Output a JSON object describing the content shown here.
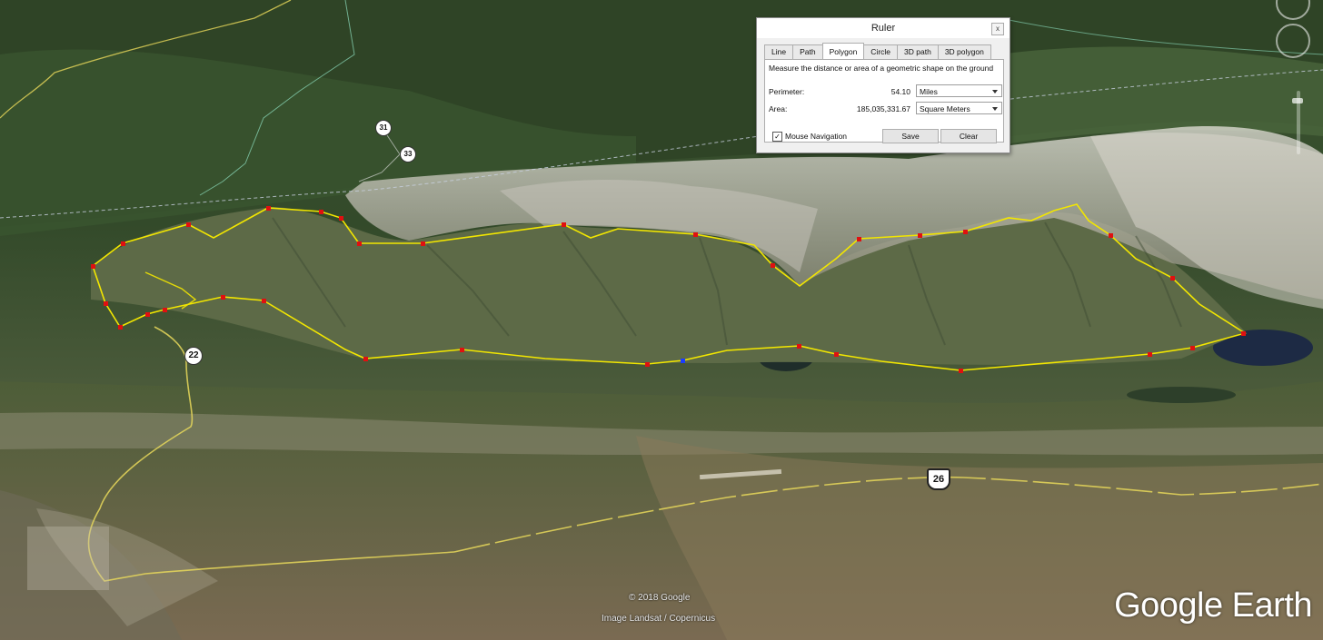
{
  "map": {
    "copyright": "© 2018 Google",
    "imagery_credit": "Image Landsat / Copernicus",
    "logo": "Google Earth",
    "route_labels": [
      "22",
      "26",
      "31",
      "33"
    ],
    "path_color": "#f2e600",
    "vertex_color": "#e01010",
    "active_vertex_color": "#1a3cff"
  },
  "ruler": {
    "title": "Ruler",
    "close_label": "x",
    "tabs": [
      {
        "label": "Line"
      },
      {
        "label": "Path"
      },
      {
        "label": "Polygon"
      },
      {
        "label": "Circle"
      },
      {
        "label": "3D path"
      },
      {
        "label": "3D polygon"
      }
    ],
    "active_tab": "Polygon",
    "description": "Measure the distance or area of a geometric shape on the ground",
    "perimeter": {
      "label": "Perimeter:",
      "value": "54.10",
      "unit": "Miles"
    },
    "area": {
      "label": "Area:",
      "value": "185,035,331.67",
      "unit": "Square Meters"
    },
    "mouse_navigation": {
      "label": "Mouse Navigation",
      "checked": true
    },
    "save_label": "Save",
    "clear_label": "Clear"
  }
}
